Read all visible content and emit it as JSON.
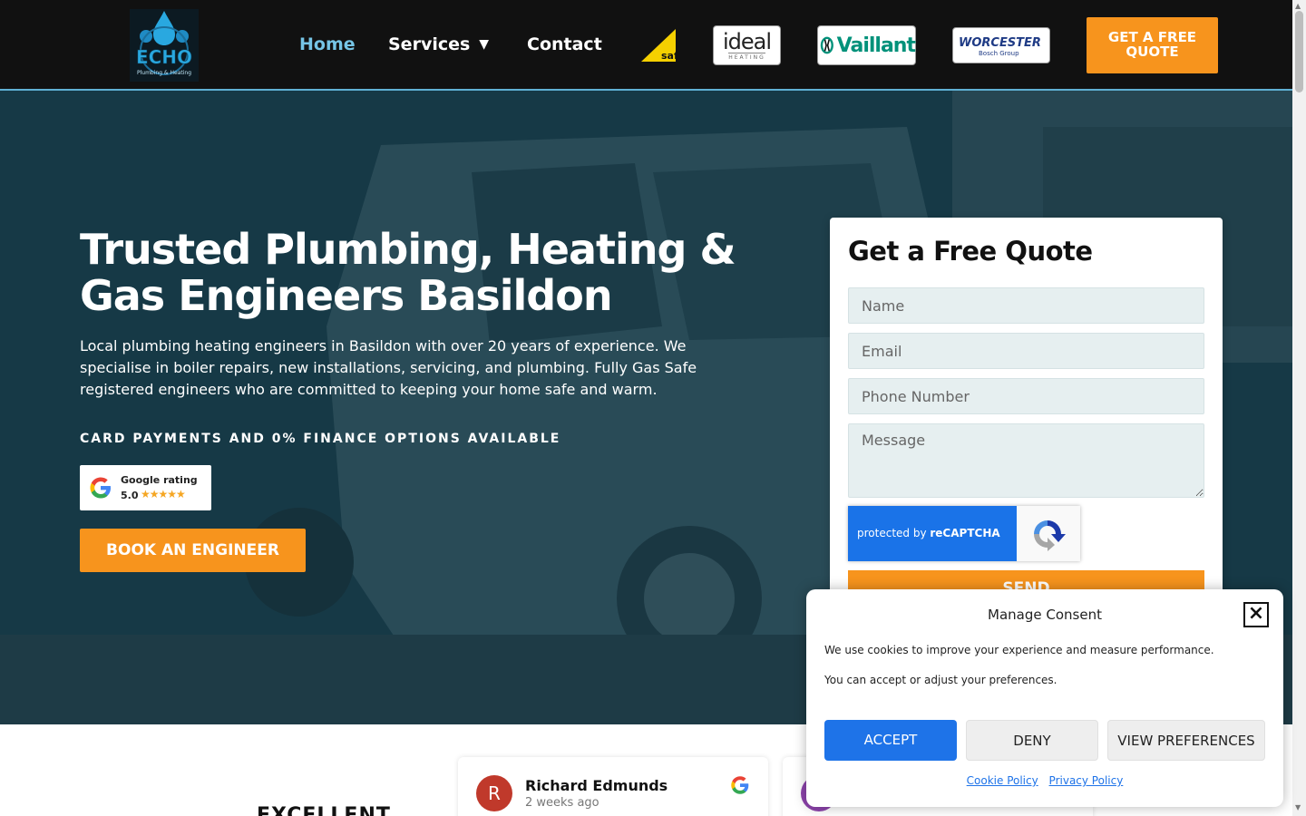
{
  "header": {
    "logo_text": "ECHO",
    "logo_sub": "Plumbing & Heating",
    "nav": {
      "home": "Home",
      "services": "Services",
      "contact": "Contact"
    },
    "brands": {
      "gas_safe": "Gas Safe",
      "ideal_big": "ideal",
      "ideal_small": "HEATING",
      "vaillant": "Vaillant",
      "worcester": "WORCESTER",
      "worcester_sub": "Bosch Group"
    },
    "cta": "GET A FREE QUOTE"
  },
  "hero": {
    "title": "Trusted Plumbing, Heating & Gas Engineers Basildon",
    "text": "Local plumbing heating engineers in Basildon with over 20 years of experience. We specialise in boiler repairs, new installations, servicing, and plumbing. Fully Gas Safe registered engineers who are committed to keeping your home safe and warm.",
    "card_payments": "CARD PAYMENTS AND 0% FINANCE OPTIONS AVAILABLE",
    "google_badge": {
      "label": "Google rating",
      "score": "5.0",
      "stars": "★★★★★"
    },
    "book_button": "BOOK AN ENGINEER"
  },
  "quote_form": {
    "title": "Get a Free Quote",
    "name_placeholder": "Name",
    "email_placeholder": "Email",
    "phone_placeholder": "Phone Number",
    "message_placeholder": "Message",
    "recaptcha_text": "protected by ",
    "recaptcha_brand": "reCAPTCHA",
    "send": "SEND"
  },
  "reviews": {
    "heading": "EXCELLENT",
    "items": [
      {
        "initial": "R",
        "name": "Richard Edmunds",
        "ago": "2 weeks ago"
      }
    ]
  },
  "consent": {
    "title": "Manage Consent",
    "close": "×",
    "line1": "We use cookies to improve your experience and measure performance.",
    "line2": "You can accept or adjust your preferences.",
    "accept": "ACCEPT",
    "deny": "DENY",
    "preferences": "VIEW PREFERENCES",
    "cookie_policy": "Cookie Policy",
    "privacy_policy": "Privacy Policy"
  },
  "colors": {
    "accent": "#f7941d",
    "nav_active": "#76c5e6",
    "consent_primary": "#1e73e8",
    "header_bg": "#111111"
  }
}
